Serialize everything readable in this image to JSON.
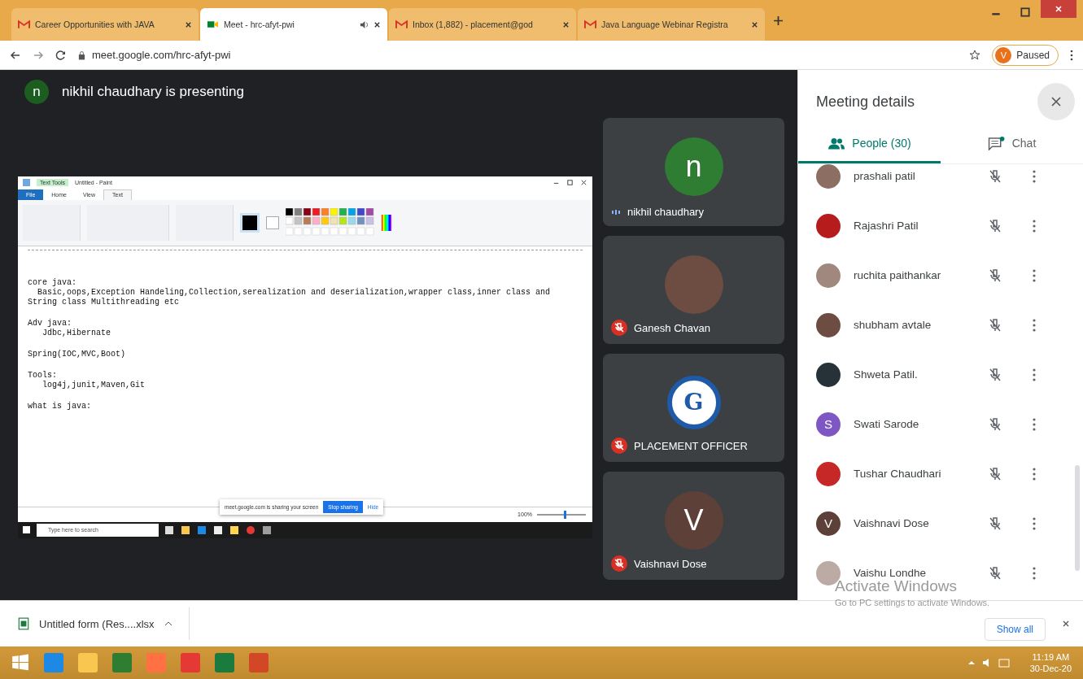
{
  "browser": {
    "tabs": [
      {
        "title": "Career Opportunities with JAVA",
        "kind": "mail",
        "selected": false,
        "audio": false
      },
      {
        "title": "Meet - hrc-afyt-pwi",
        "kind": "meet",
        "selected": true,
        "audio": true
      },
      {
        "title": "Inbox (1,882) - placement@god",
        "kind": "mail",
        "selected": false,
        "audio": false
      },
      {
        "title": "Java Language Webinar Registra",
        "kind": "mail",
        "selected": false,
        "audio": false
      }
    ],
    "url": "meet.google.com/hrc-afyt-pwi",
    "profile": {
      "letter": "V",
      "status": "Paused"
    }
  },
  "presenter": {
    "letter": "n",
    "text": "nikhil chaudhary is presenting"
  },
  "shared_screen": {
    "title": "Untitled - Paint",
    "context_tab": "Text Tools",
    "ribbon_tabs": [
      {
        "label": "File",
        "selected": false
      },
      {
        "label": "Home",
        "selected": false
      },
      {
        "label": "View",
        "selected": false
      },
      {
        "label": "Text",
        "selected": true
      }
    ],
    "document_blocks": [
      {
        "lines": [
          "core java:",
          "  Basic,oops,Exception Handeling,Collection,serealization and deserialization,wrapper class,inner class and",
          "String class Multithreading etc"
        ]
      },
      {
        "lines": [
          "Adv java:",
          "   Jdbc,Hibernate"
        ]
      },
      {
        "lines": [
          "Spring(IOC,MVC,Boot)"
        ]
      },
      {
        "lines": [
          "Tools:",
          "   log4j,junit,Maven,Git"
        ]
      },
      {
        "lines": [
          "what is java:"
        ]
      }
    ],
    "sharing_bar": {
      "text": "meet.google.com is sharing your screen",
      "stop": "Stop sharing",
      "hide": "Hide"
    },
    "zoom": "100%",
    "zoom_slider": {
      "level": 0.55
    },
    "search_placeholder": "Type here to search"
  },
  "tiles": [
    {
      "name": "nikhil chaudhary",
      "kind": "letter",
      "letter": "n",
      "color": "#2e7d32",
      "muted": false
    },
    {
      "name": "Ganesh Chavan",
      "kind": "photo",
      "muted": true
    },
    {
      "name": "PLACEMENT OFFICER",
      "kind": "logo",
      "letter": "G",
      "muted": true
    },
    {
      "name": "Vaishnavi Dose",
      "kind": "letter",
      "letter": "V",
      "color": "#5d4037",
      "muted": true
    }
  ],
  "panel": {
    "title": "Meeting details",
    "tabs": [
      {
        "label": "People (30)",
        "kind": "people",
        "selected": true
      },
      {
        "label": "Chat",
        "kind": "chat",
        "selected": false
      }
    ],
    "people": [
      {
        "name": "prashali patil",
        "kind": "photo",
        "muted": true
      },
      {
        "name": "Rajashri Patil",
        "kind": "photo",
        "muted": true
      },
      {
        "name": "ruchita paithankar",
        "kind": "photo",
        "muted": true
      },
      {
        "name": "shubham avtale",
        "kind": "photo",
        "muted": true
      },
      {
        "name": "Shweta Patil.",
        "kind": "photo",
        "muted": true
      },
      {
        "name": "Swati Sarode",
        "kind": "letter",
        "letter": "S",
        "color": "#7e57c2",
        "muted": true
      },
      {
        "name": "Tushar Chaudhari",
        "kind": "photo",
        "muted": true
      },
      {
        "name": "Vaishnavi Dose",
        "kind": "letter",
        "letter": "V",
        "color": "#5d4037",
        "muted": true
      },
      {
        "name": "Vaishu Londhe",
        "kind": "photo",
        "muted": true
      }
    ]
  },
  "activation": {
    "title": "Activate Windows",
    "subtitle": "Go to PC settings to activate Windows."
  },
  "downloads": {
    "file": "Untitled form (Res....xlsx",
    "show_all": "Show all"
  },
  "taskbar": {
    "time": "11:19 AM",
    "date": "30-Dec-20"
  }
}
